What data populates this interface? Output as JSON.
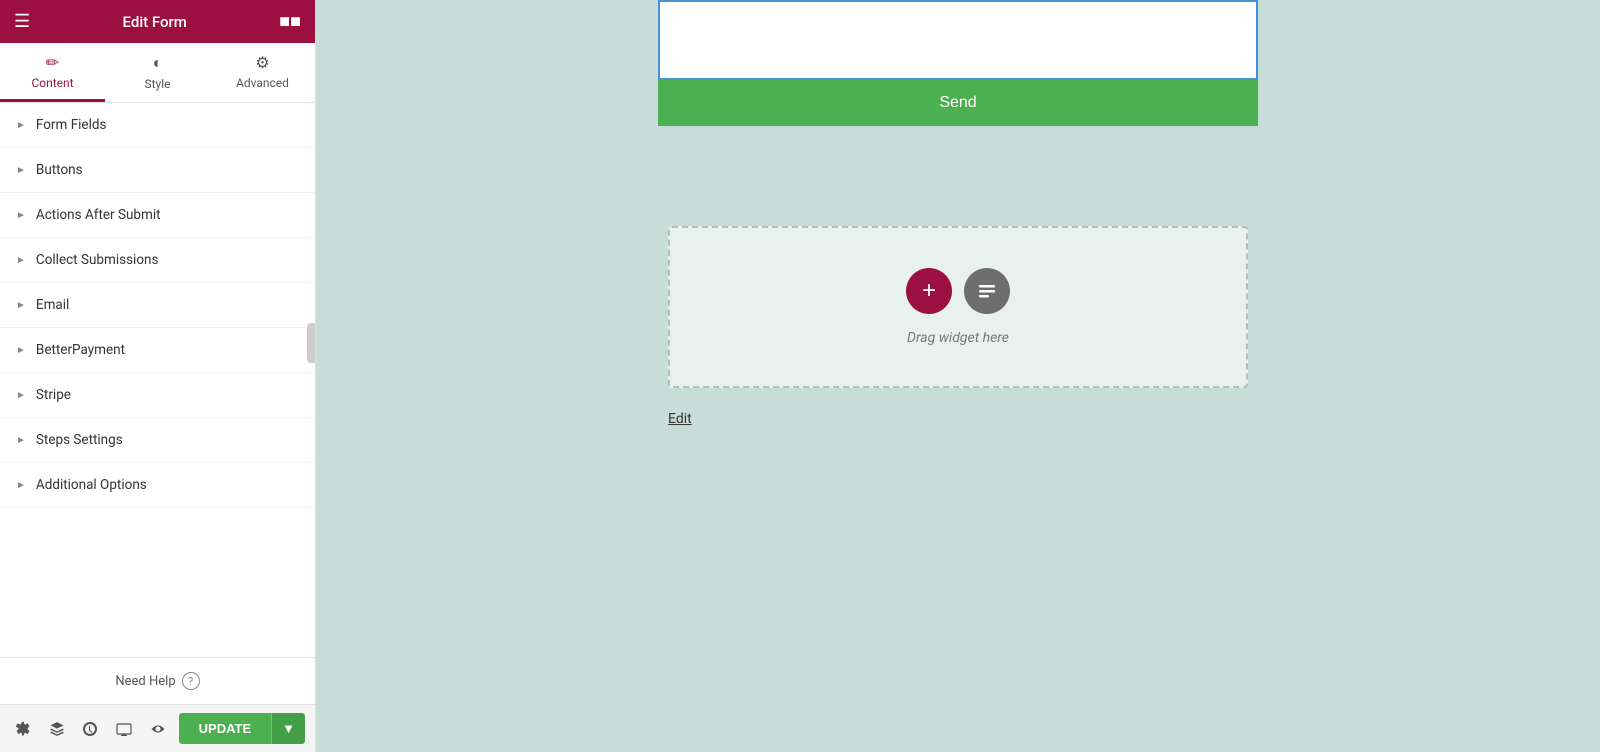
{
  "header": {
    "title": "Edit Form",
    "menu_icon": "≡",
    "grid_icon": "⊞"
  },
  "tabs": [
    {
      "id": "content",
      "label": "Content",
      "icon": "✏",
      "active": true
    },
    {
      "id": "style",
      "label": "Style",
      "icon": "◐",
      "active": false
    },
    {
      "id": "advanced",
      "label": "Advanced",
      "icon": "⚙",
      "active": false
    }
  ],
  "accordion": [
    {
      "id": "form-fields",
      "label": "Form Fields"
    },
    {
      "id": "buttons",
      "label": "Buttons"
    },
    {
      "id": "actions-after-submit",
      "label": "Actions After Submit"
    },
    {
      "id": "collect-submissions",
      "label": "Collect Submissions"
    },
    {
      "id": "email",
      "label": "Email"
    },
    {
      "id": "better-payment",
      "label": "BetterPayment"
    },
    {
      "id": "stripe",
      "label": "Stripe"
    },
    {
      "id": "steps-settings",
      "label": "Steps Settings"
    },
    {
      "id": "additional-options",
      "label": "Additional Options"
    }
  ],
  "footer": {
    "need_help_label": "Need Help",
    "help_icon": "?"
  },
  "bottom_toolbar": {
    "icons": [
      "⚙",
      "⊡",
      "↺",
      "⬚",
      "👁"
    ],
    "update_label": "UPDATE",
    "dropdown_icon": "▾"
  },
  "canvas": {
    "send_button_label": "Send",
    "dropzone_label": "Drag widget here",
    "edit_link_label": "Edit"
  }
}
